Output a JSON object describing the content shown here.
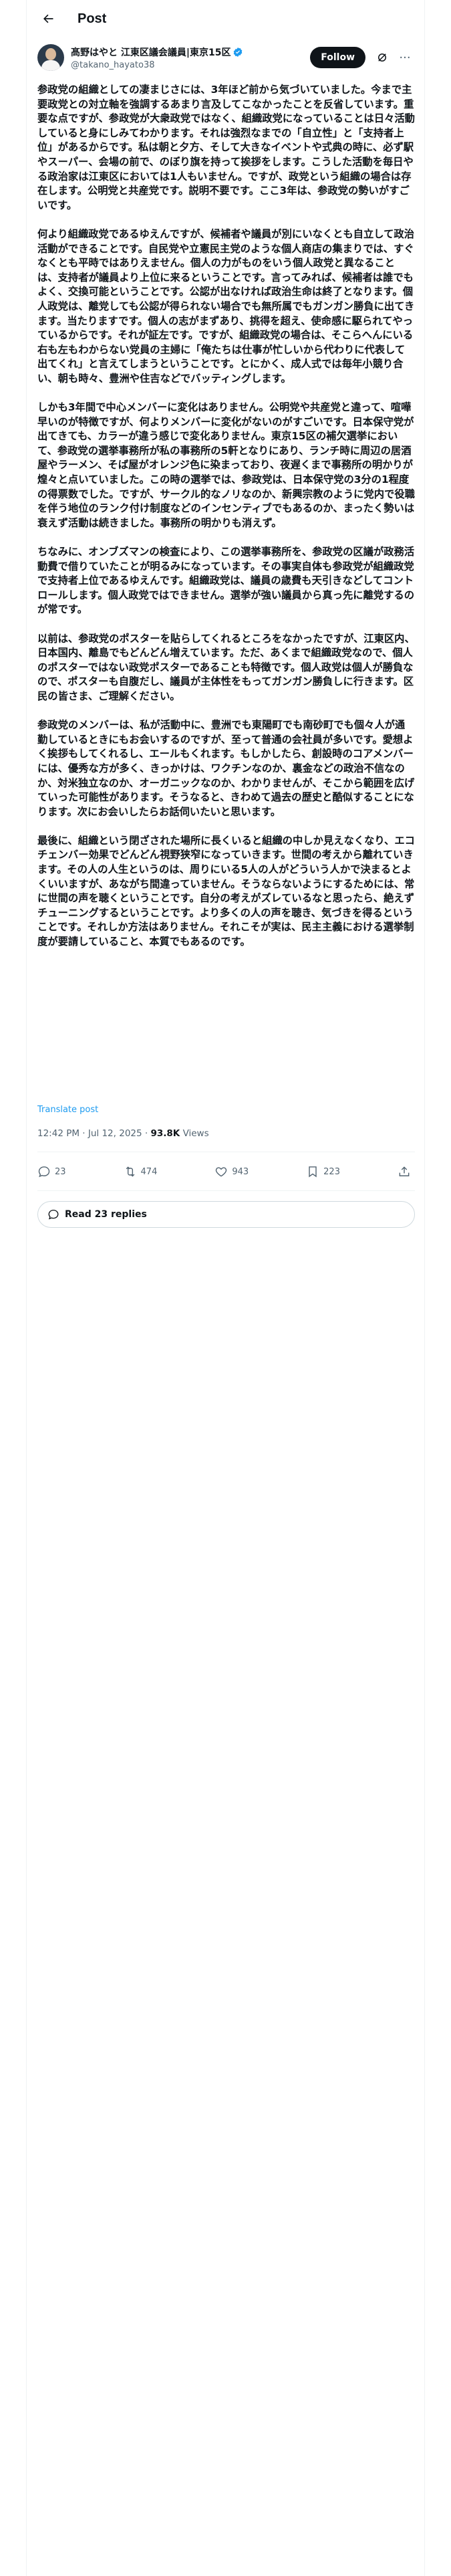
{
  "header": {
    "title": "Post"
  },
  "author": {
    "display_name": "髙野はやと 江東区議会議員|東京15区",
    "handle": "@takano_hayato38",
    "follow_label": "Follow"
  },
  "tweet": {
    "paragraphs": [
      "参政党の組織としての凄まじさには、3年ほど前から気づいていました。今まで主要政党との対立軸を強調するあまり言及してこなかったことを反省しています。重要な点ですが、参政党が大衆政党ではなく、組織政党になっていることは日々活動していると身にしみてわかります。それは強烈なまでの「自立性」と「支持者上位」があるからです。私は朝と夕方、そして大きなイベントや式典の時に、必ず駅やスーパー、会場の前で、のぼり旗を持って挨拶をします。こうした活動を毎日やる政治家は江東区においては1人もいません。ですが、政党という組織の場合は存在します。公明党と共産党です。説明不要です。ここ3年は、参政党の勢いがすごいです。",
      "何より組織政党であるゆえんですが、候補者や議員が別にいなくとも自立して政治活動ができることです。自民党や立憲民主党のような個人商店の集まりでは、すぐなくとも平時ではありえません。個人の力がものをいう個人政党と異なることは、支持者が議員より上位に来るということです。言ってみれば、候補者は誰でもよく、交換可能ということです。公認が出なければ政治生命は終了となります。個人政党は、離党しても公認が得られない場合でも無所属でもガンガン勝負に出てきます。当たりますです。個人の志がまずあり、挑得を超え、使命感に駆られてやっているからです。それが証左です。ですが、組織政党の場合は、そこらへんにいる右も左もわからない党員の主婦に「俺たちは仕事が忙しいから代わりに代表して出てくれ」と言えてしまうということです。とにかく、成人式では毎年小競り合い、朝も時々、豊洲や住吉などでバッティングします。",
      "しかも3年間で中心メンバーに変化はありません。公明党や共産党と違って、喧嘩早いのが特徴ですが、何よりメンバーに変化がないのがすごいです。日本保守党が出てきても、カラーが違う感じで変化ありません。東京15区の補欠選挙において、参政党の選挙事務所が私の事務所の5軒となりにあり、ランチ時に周辺の居酒屋やラーメン、そば屋がオレンジ色に染まっており、夜遅くまで事務所の明かりが煌々と点いていました。この時の選挙では、参政党は、日本保守党の3分の1程度の得票数でした。ですが、サークル的なノリなのか、新興宗教のように党内で役職を伴う地位のランク付け制度などのインセンティブでもあるのか、まったく勢いは衰えず活動は続きました。事務所の明かりも消えず。",
      "ちなみに、オンブズマンの検査により、この選挙事務所を、参政党の区議が政務活動費で借りていたことが明るみになっています。その事実自体も参政党が組織政党で支持者上位であるゆえんです。組織政党は、議員の歳費も天引きなどしてコントロールします。個人政党ではできません。選挙が強い議員から真っ先に離党するのが常です。",
      "以前は、参政党のポスターを貼らしてくれるところをなかったですが、江東区内、日本国内、離島でもどんどん増えています。ただ、あくまで組織政党なので、個人のポスターではない政党ポスターであることも特徴です。個人政党は個人が勝負なので、ポスターも自腹だし、議員が主体性をもってガンガン勝負しに行きます。区民の皆さま、ご理解ください。",
      "参政党のメンバーは、私が活動中に、豊洲でも東陽町でも南砂町でも個々人が通勤しているときにもお会いするのですが、至って普通の会社員が多いです。愛想よく挨拶もしてくれるし、エールもくれます。もしかしたら、創設時のコアメンバーには、優秀な方が多く、きっかけは、ワクチンなのか、裏金などの政治不信なのか、対米独立なのか、オーガニックなのか、わかりませんが、そこから範囲を広げていった可能性があります。そうなると、きわめて過去の歴史と酷似することになります。次にお会いしたらお話伺いたいと思います。",
      "最後に、組織という閉ざされた場所に長くいると組織の中しか見えなくなり、エコチェンバー効果でどんどん視野狭窄になっていきます。世間の考えから離れていきます。その人の人生というのは、周りにいる5人の人がどういう人かで決まるとよくいいますが、あながち間違っていません。そうならないようにするためには、常に世間の声を聴くということです。自分の考えがズレているなと思ったら、絶えずチューニングするということです。より多くの人の声を聴き、気づきを得るということです。それしか方法はありません。それこそが実は、民主主義における選挙制度が要請していること、本質でもあるのです。"
    ],
    "translate_label": "Translate post",
    "time": "12:42 PM",
    "date": "Jul 12, 2025",
    "views_count": "93.8K",
    "views_label": "Views"
  },
  "actions": {
    "replies": "23",
    "reposts": "474",
    "likes": "943",
    "bookmarks": "223"
  },
  "read_replies_label": "Read 23 replies",
  "colors": {
    "accent": "#1d9bf0",
    "text": "#0f1419",
    "muted": "#536471",
    "border": "#eff3f4"
  }
}
